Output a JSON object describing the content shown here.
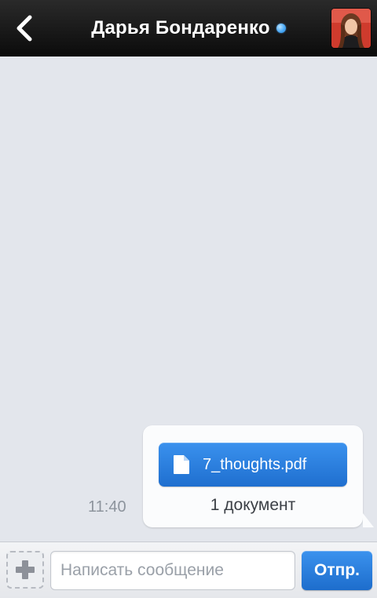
{
  "header": {
    "contact_name": "Дарья Бондаренко",
    "online_status_color": "#4aa9f5",
    "back_icon": "chevron-left-icon",
    "avatar_icon": "contact-avatar"
  },
  "chat": {
    "messages": [
      {
        "time": "11:40",
        "attachment": {
          "icon": "document-icon",
          "file_name": "7_thoughts.pdf"
        },
        "summary": "1 документ"
      }
    ]
  },
  "composer": {
    "attach_icon": "plus-icon",
    "placeholder": "Написать сообщение",
    "value": "",
    "send_label": "Отпр."
  },
  "colors": {
    "accent": "#2a80dd",
    "header_bg": "#111111",
    "chat_bg": "#e3e6ec"
  }
}
